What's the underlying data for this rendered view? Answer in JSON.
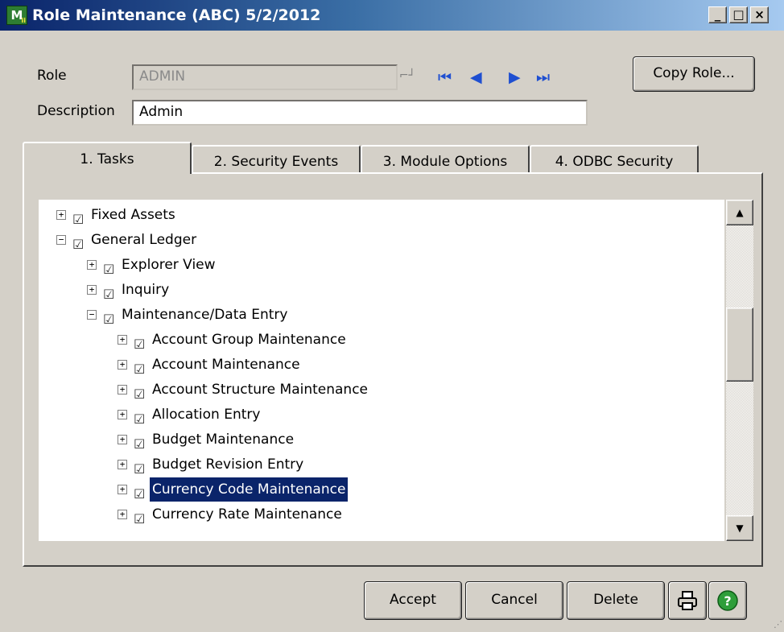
{
  "window": {
    "title": "Role Maintenance (ABC) 5/2/2012",
    "app_icon_letter": "M",
    "app_icon_sub": "ii",
    "controls": {
      "minimize": "_",
      "maximize": "□",
      "close": "×"
    }
  },
  "form": {
    "role_label": "Role",
    "role_value": "ADMIN",
    "description_label": "Description",
    "description_value": "Admin",
    "copy_role_label": "Copy Role...",
    "nav": [
      "first-record-icon",
      "previous-record-icon",
      "next-record-icon",
      "last-record-icon"
    ]
  },
  "tabs": [
    {
      "label": "1. Tasks",
      "active": true
    },
    {
      "label": "2. Security Events",
      "active": false
    },
    {
      "label": "3. Module Options",
      "active": false
    },
    {
      "label": "4. ODBC Security",
      "active": false
    }
  ],
  "tree": {
    "items": [
      {
        "label": "Fixed Assets",
        "level": 1,
        "expanded": false,
        "checked": true,
        "selected": false
      },
      {
        "label": "General Ledger",
        "level": 1,
        "expanded": true,
        "checked": true,
        "selected": false
      },
      {
        "label": "Explorer View",
        "level": 2,
        "expanded": false,
        "checked": true,
        "selected": false
      },
      {
        "label": "Inquiry",
        "level": 2,
        "expanded": false,
        "checked": true,
        "selected": false
      },
      {
        "label": "Maintenance/Data Entry",
        "level": 2,
        "expanded": true,
        "checked": true,
        "selected": false
      },
      {
        "label": "Account Group Maintenance",
        "level": 3,
        "expanded": false,
        "checked": true,
        "selected": false
      },
      {
        "label": "Account Maintenance",
        "level": 3,
        "expanded": false,
        "checked": true,
        "selected": false
      },
      {
        "label": "Account Structure Maintenance",
        "level": 3,
        "expanded": false,
        "checked": true,
        "selected": false
      },
      {
        "label": "Allocation Entry",
        "level": 3,
        "expanded": false,
        "checked": true,
        "selected": false
      },
      {
        "label": "Budget Maintenance",
        "level": 3,
        "expanded": false,
        "checked": true,
        "selected": false
      },
      {
        "label": "Budget Revision Entry",
        "level": 3,
        "expanded": false,
        "checked": true,
        "selected": false
      },
      {
        "label": "Currency Code Maintenance",
        "level": 3,
        "expanded": false,
        "checked": true,
        "selected": true
      },
      {
        "label": "Currency Rate Maintenance",
        "level": 3,
        "expanded": false,
        "checked": true,
        "selected": false
      }
    ],
    "scroll_position": 0.38
  },
  "footer": {
    "accept_label": "Accept",
    "cancel_label": "Cancel",
    "delete_label": "Delete",
    "print_icon": "printer-icon",
    "help_icon": "help-icon"
  },
  "colors": {
    "selection_bg": "#0a246a",
    "nav_icon": "#1f4fd1",
    "help_green": "#2e9e3a"
  }
}
